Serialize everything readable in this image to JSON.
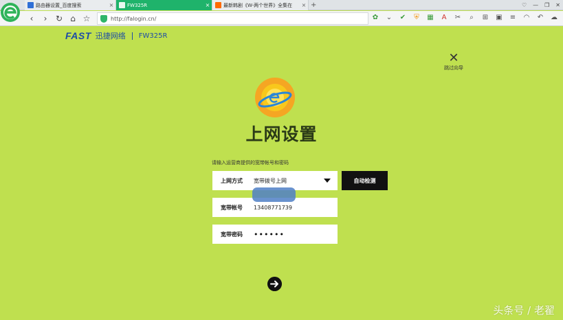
{
  "browser": {
    "tabs": [
      {
        "label": "路由器设置_百度搜索",
        "close": "×"
      },
      {
        "label": "FW325R",
        "close": "×"
      },
      {
        "label": "最新韩剧《W-两个世界》全集在",
        "close": "×"
      }
    ],
    "new_tab": "+",
    "url": "http://falogin.cn/"
  },
  "brand": {
    "logo": "FAST",
    "name_cn": "迅捷网络",
    "model": "FW325R"
  },
  "skip_wizard": {
    "label": "跳过向导"
  },
  "page": {
    "title": "上网设置",
    "hint": "请输入运营商提供的宽带帐号和密码"
  },
  "form": {
    "mode_label": "上网方式",
    "mode_value": "宽带拨号上网",
    "account_label": "宽带帐号",
    "account_value": "13408771739",
    "password_label": "宽带密码",
    "password_value": "••••••",
    "detect_button": "自动检测"
  },
  "watermark": "头条号 / 老翟",
  "colors": {
    "page_bg": "#bfe04f",
    "brand_blue": "#1b4aa8",
    "active_tab": "#1fb36b"
  }
}
